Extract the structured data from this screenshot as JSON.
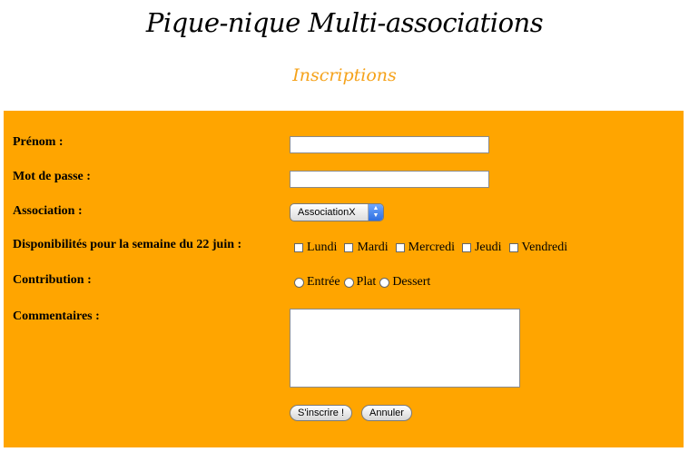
{
  "header": {
    "title": "Pique-nique Multi-associations",
    "subtitle": "Inscriptions"
  },
  "colors": {
    "panel_bg": "#ffa500",
    "subtitle": "#f5a21a"
  },
  "form": {
    "prenom": {
      "label": "Prénom :",
      "value": ""
    },
    "password": {
      "label": "Mot de passe :",
      "value": ""
    },
    "association": {
      "label": "Association :",
      "selected": "AssociationX"
    },
    "disponibilites": {
      "label": "Disponibilités pour la semaine du 22 juin :",
      "options": [
        "Lundi",
        "Mardi",
        "Mercredi",
        "Jeudi",
        "Vendredi"
      ]
    },
    "contribution": {
      "label": "Contribution :",
      "options": [
        "Entrée",
        "Plat",
        "Dessert"
      ]
    },
    "commentaires": {
      "label": "Commentaires :",
      "value": ""
    },
    "submit_label": "S'inscrire !",
    "reset_label": "Annuler"
  }
}
